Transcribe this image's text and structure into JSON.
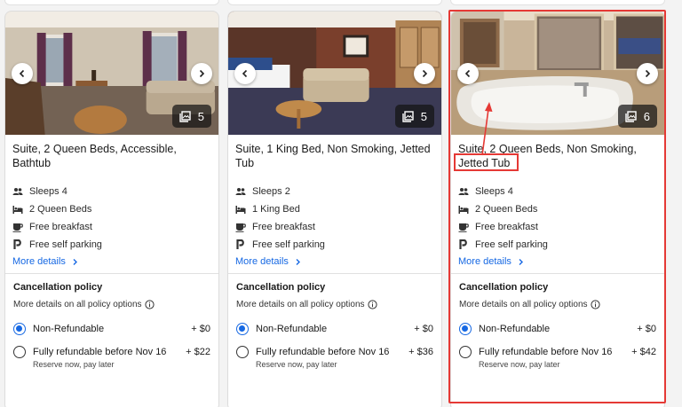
{
  "cards": [
    {
      "photo_count": "5",
      "title": "Suite, 2 Queen Beds, Accessible, Bathtub",
      "amenities": {
        "sleeps": "Sleeps 4",
        "beds": "2 Queen Beds",
        "breakfast": "Free breakfast",
        "parking": "Free self parking"
      },
      "more_details": "More details",
      "cancellation_title": "Cancellation policy",
      "policy_link": "More details on all policy options",
      "option1": {
        "label": "Non-Refundable",
        "price": "+ $0"
      },
      "option2": {
        "label": "Fully refundable before Nov 16",
        "note": "Reserve now, pay later",
        "price": "+ $22"
      }
    },
    {
      "photo_count": "5",
      "title": "Suite, 1 King Bed, Non Smoking, Jetted Tub",
      "amenities": {
        "sleeps": "Sleeps 2",
        "beds": "1 King Bed",
        "breakfast": "Free breakfast",
        "parking": "Free self parking"
      },
      "more_details": "More details",
      "cancellation_title": "Cancellation policy",
      "policy_link": "More details on all policy options",
      "option1": {
        "label": "Non-Refundable",
        "price": "+ $0"
      },
      "option2": {
        "label": "Fully refundable before Nov 16",
        "note": "Reserve now, pay later",
        "price": "+ $36"
      }
    },
    {
      "photo_count": "6",
      "title": "Suite, 2 Queen Beds, Non Smoking, Jetted Tub",
      "amenities": {
        "sleeps": "Sleeps 4",
        "beds": "2 Queen Beds",
        "breakfast": "Free breakfast",
        "parking": "Free self parking"
      },
      "more_details": "More details",
      "cancellation_title": "Cancellation policy",
      "policy_link": "More details on all policy options",
      "option1": {
        "label": "Non-Refundable",
        "price": "+ $0"
      },
      "option2": {
        "label": "Fully refundable before Nov 16",
        "note": "Reserve now, pay later",
        "price": "+ $42"
      }
    }
  ],
  "selected_option": "Non-Refundable",
  "colors": {
    "link": "#1668e3",
    "annotation": "#e53935",
    "radio_selected": "#1668e3"
  },
  "icons": [
    "chevron-left-icon",
    "chevron-right-icon",
    "photo-gallery-icon",
    "people-icon",
    "bed-icon",
    "coffee-icon",
    "parking-icon",
    "info-icon"
  ]
}
